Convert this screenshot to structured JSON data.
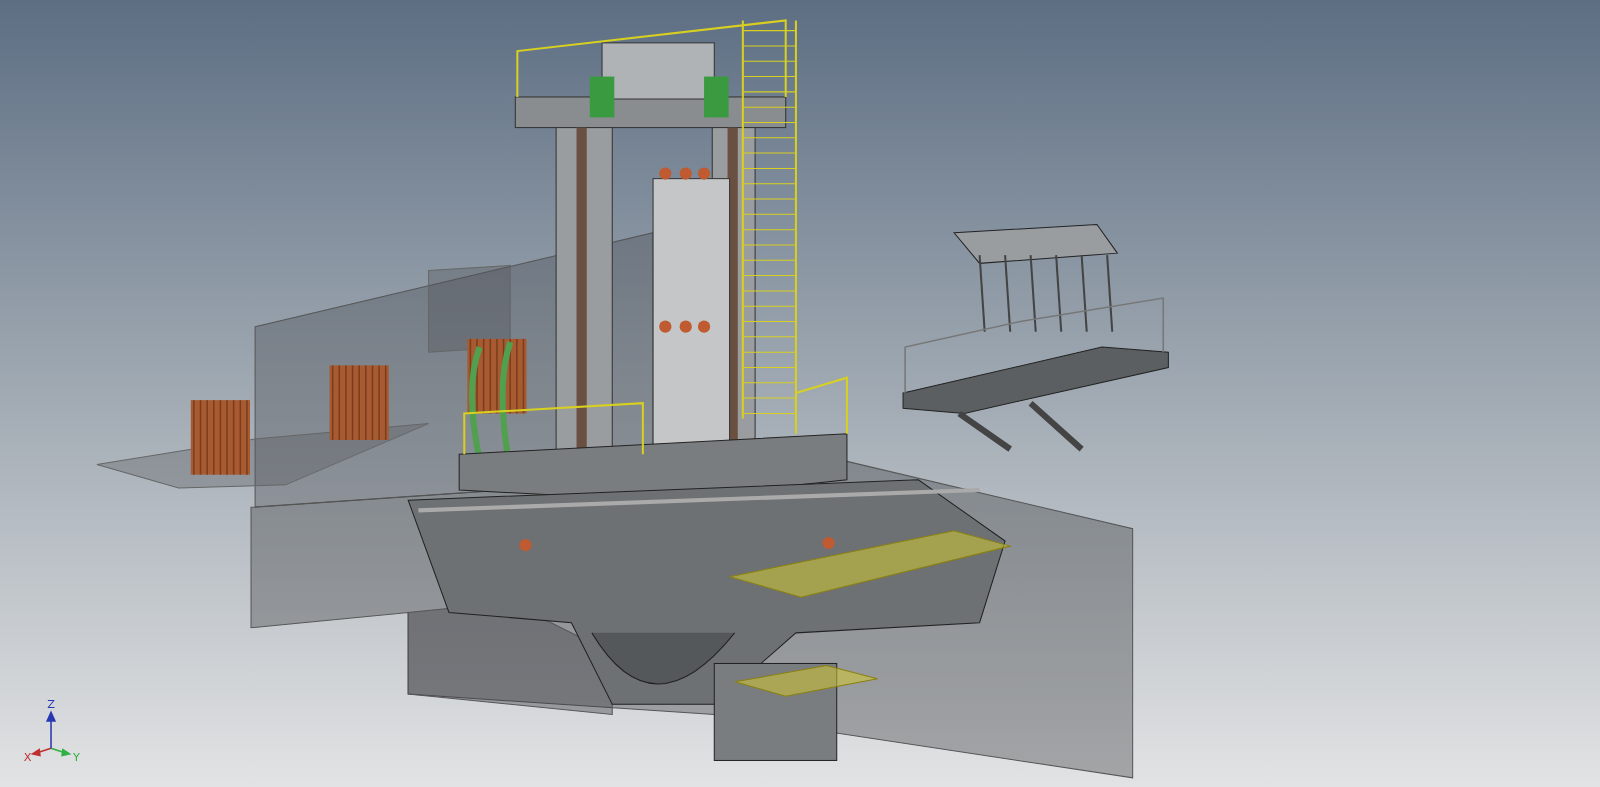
{
  "axis_triad": {
    "axes": [
      {
        "label": "X",
        "color": "#c03030"
      },
      {
        "label": "Y",
        "color": "#30b040"
      },
      {
        "label": "Z",
        "color": "#2838b0"
      }
    ]
  }
}
